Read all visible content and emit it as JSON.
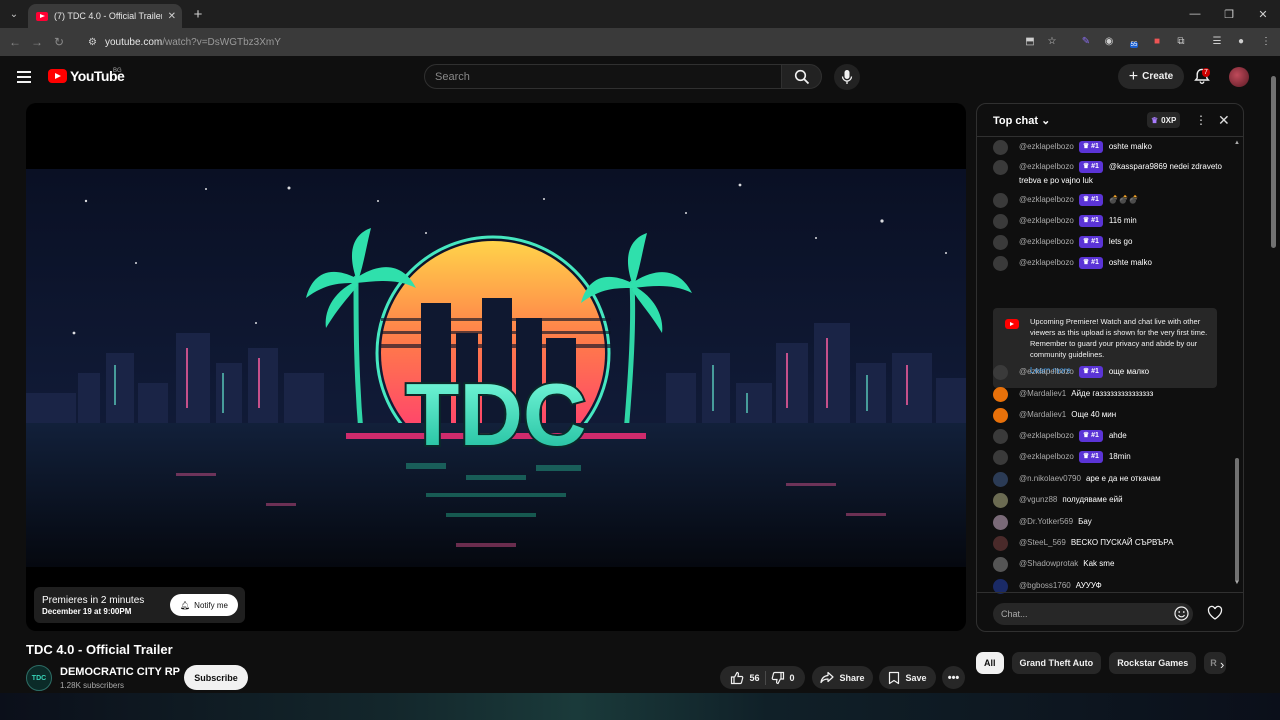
{
  "browser": {
    "tab_title": "(7) TDC 4.0 - Official Trailer - Yo",
    "url_host": "youtube.com",
    "url_path": "/watch?v=DsWGTbz3XmY",
    "ext_badge": "55"
  },
  "header": {
    "logo_text": "YouTube",
    "country_code": "BG",
    "search_placeholder": "Search",
    "create_label": "Create",
    "notif_count": "7"
  },
  "player": {
    "art_logo": "TDC",
    "premiere_text": "Premieres in 2 minutes",
    "premiere_date": "December 19 at 9:00PM",
    "notify_label": "Notify me"
  },
  "video": {
    "title": "TDC 4.0 - Official Trailer",
    "channel_name": "DEMOCRATIC CITY RP",
    "channel_avatar_text": "TDC",
    "subscribers": "1.28K subscribers",
    "subscribe_label": "Subscribe",
    "likes": "56",
    "dislikes": "0",
    "share_label": "Share",
    "save_label": "Save"
  },
  "chat": {
    "header_label": "Top chat",
    "xp_label": "0XP",
    "messages_top": [
      {
        "author": "@ezklapelbozo",
        "badge": "#1",
        "text": "oshte malko",
        "avatar_color": "#3a3a3a"
      },
      {
        "author": "@ezklapelbozo",
        "badge": "#1",
        "text": "@kasspara9869 nedei zdraveto trebva e po vajno luk",
        "avatar_color": "#3a3a3a"
      },
      {
        "author": "@ezklapelbozo",
        "badge": "#1",
        "text": "💣💣💣",
        "avatar_color": "#3a3a3a"
      },
      {
        "author": "@ezklapelbozo",
        "badge": "#1",
        "text": "116 min",
        "avatar_color": "#3a3a3a"
      },
      {
        "author": "@ezklapelbozo",
        "badge": "#1",
        "text": "lets go",
        "avatar_color": "#3a3a3a"
      },
      {
        "author": "@ezklapelbozo",
        "badge": "#1",
        "text": "oshte malko",
        "avatar_color": "#3a3a3a"
      }
    ],
    "notice_text": "Upcoming Premiere! Watch and chat live with other viewers as this upload is shown for the very first time. Remember to guard your privacy and abide by our community guidelines.",
    "learn_more": "Learn more",
    "messages_bottom": [
      {
        "author": "@ezklapelbozo",
        "badge": "#1",
        "text": "още малко",
        "avatar_color": "#3a3a3a"
      },
      {
        "author": "@Mardaliev1",
        "badge": "",
        "text": "Айде газзззззззззззззз",
        "avatar_color": "#e8710a"
      },
      {
        "author": "@Mardaliev1",
        "badge": "",
        "text": "Още 40 мин",
        "avatar_color": "#e8710a"
      },
      {
        "author": "@ezklapelbozo",
        "badge": "#1",
        "text": "ahde",
        "avatar_color": "#3a3a3a"
      },
      {
        "author": "@ezklapelbozo",
        "badge": "#1",
        "text": "18min",
        "avatar_color": "#3a3a3a"
      },
      {
        "author": "@n.nikolaev0790",
        "badge": "",
        "text": "аре е да не откачам",
        "avatar_color": "#2b3b55"
      },
      {
        "author": "@vgunz88",
        "badge": "",
        "text": "полудяваме ейй",
        "avatar_color": "#6b6b52"
      },
      {
        "author": "@Dr.Yotker569",
        "badge": "",
        "text": "Бау",
        "avatar_color": "#7a6a78"
      },
      {
        "author": "@SteeL_569",
        "badge": "",
        "text": "ВЕСКО ПУСКАЙ СЪРВЪРА",
        "avatar_color": "#4a2a2a"
      },
      {
        "author": "@Shadowprotak",
        "badge": "",
        "text": "Kak sme",
        "avatar_color": "#555"
      },
      {
        "author": "@bgboss1760",
        "badge": "",
        "text": "АУУУФ",
        "avatar_color": "#1a2a66"
      }
    ],
    "input_placeholder": "Chat..."
  },
  "chips": {
    "items": [
      "All",
      "Grand Theft Auto",
      "Rockstar Games",
      "R"
    ]
  }
}
